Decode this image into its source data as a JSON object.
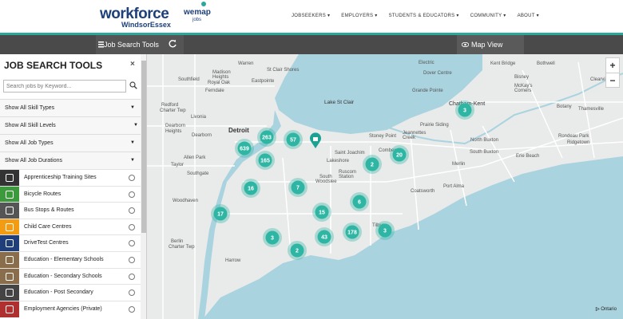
{
  "header": {
    "logo_main": "workforce",
    "logo_sub": "WindsorEssex",
    "partner_logo": "wemap",
    "partner_sub": "jobs",
    "nav": [
      "JOBSEEKERS ▾",
      "EMPLOYERS ▾",
      "STUDENTS & EDUCATORS ▾",
      "COMMUNITY ▾",
      "ABOUT ▾"
    ]
  },
  "toolbar": {
    "job_search_tools": "Job Search Tools",
    "map_view": "Map View"
  },
  "sidebar": {
    "title": "JOB SEARCH TOOLS",
    "close": "×",
    "search_placeholder": "Search jobs by Keyword...",
    "filters": [
      "Show All Skill Types",
      "Show All Skill Levels",
      "Show All Job Types",
      "Show All Job Durations"
    ],
    "layers": [
      {
        "label": "Apprenticeship Training Sites",
        "color": "#333333",
        "icon": "wrench-icon"
      },
      {
        "label": "Bicycle Routes",
        "color": "#3c9a3c",
        "icon": "bicycle-icon"
      },
      {
        "label": "Bus Stops & Routes",
        "color": "#555555",
        "icon": "bus-icon"
      },
      {
        "label": "Child Care Centres",
        "color": "#f39c12",
        "icon": "child-icon"
      },
      {
        "label": "DriveTest Centres",
        "color": "#1f3f7a",
        "icon": "car-icon"
      },
      {
        "label": "Education - Elementary Schools",
        "color": "#8a6d4b",
        "icon": "school-icon"
      },
      {
        "label": "Education - Secondary Schools",
        "color": "#8a6d4b",
        "icon": "school-icon"
      },
      {
        "label": "Education - Post Secondary",
        "color": "#444444",
        "icon": "graduation-cap-icon"
      },
      {
        "label": "Employment Agencies (Private)",
        "color": "#b03030",
        "icon": "briefcase-icon"
      }
    ]
  },
  "map": {
    "cluster_color": "#2fb5a3",
    "places": [
      "Warren",
      "St Clair Shores",
      "Madison Heights",
      "Royal Oak",
      "Southfield",
      "Eastpointe",
      "Ferndale",
      "Redford Charter Twp",
      "Dearborn Heights",
      "Dearborn",
      "Livonia",
      "Detroit",
      "Allen Park",
      "Taylor",
      "Southgate",
      "Woodhaven",
      "Berlin Charter Twp",
      "Harrow",
      "Lake St Clair",
      "Saint Joachim",
      "Lakeshore",
      "Ruscom Station",
      "South Woodslee",
      "Comber",
      "Jeannettes Creek",
      "Stoney Point",
      "Prairie Siding",
      "Tilbury",
      "North Buxton",
      "South Buxton",
      "Merlin",
      "Port Alma",
      "Erie Beach",
      "Chatham-Kent",
      "Dover Centre",
      "Electric",
      "Kent Bridge",
      "Bothwell",
      "Grande Pointe",
      "McKay's Corners",
      "Botany",
      "Thamesville",
      "Ridgetown",
      "Rondeau Park",
      "Coatsworth"
    ],
    "clusters": [
      263,
      57,
      639,
      165,
      2,
      20,
      16,
      7,
      6,
      15,
      17,
      3,
      43,
      178,
      3,
      2,
      3
    ],
    "zoom_in": "+",
    "zoom_out": "−",
    "region_label": "Ontario"
  }
}
